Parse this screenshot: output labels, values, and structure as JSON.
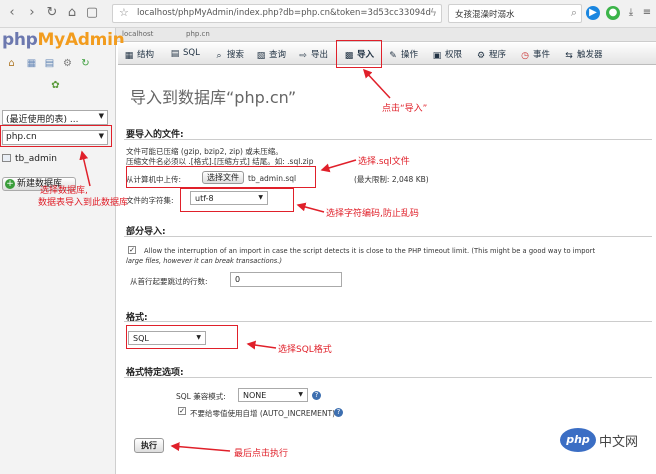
{
  "browser": {
    "url": "localhost/phpMyAdmin/index.php?db=php.cn&token=3d53cc33094d",
    "search_text": "女孩混澡时溺水",
    "frame_tabs": [
      "localhost",
      "php.cn"
    ]
  },
  "left_panel": {
    "logo_part1": "php",
    "logo_part2": "MyAdmin",
    "recent_select": "(最近使用的表) ...",
    "db_select": "php.cn",
    "table_item": "tb_admin",
    "new_db_button": "新建数据库"
  },
  "menu": {
    "tabs": [
      {
        "label": "结构",
        "icon": "structure-icon"
      },
      {
        "label": "SQL",
        "icon": "sql-icon"
      },
      {
        "label": "搜索",
        "icon": "search-icon"
      },
      {
        "label": "查询",
        "icon": "query-icon"
      },
      {
        "label": "导出",
        "icon": "export-icon"
      },
      {
        "label": "导入",
        "icon": "import-icon"
      },
      {
        "label": "操作",
        "icon": "wrench-icon"
      },
      {
        "label": "权限",
        "icon": "privileges-icon"
      },
      {
        "label": "程序",
        "icon": "routines-icon"
      },
      {
        "label": "事件",
        "icon": "events-icon"
      },
      {
        "label": "触发器",
        "icon": "triggers-icon"
      }
    ]
  },
  "main": {
    "title": "导入到数据库“php.cn”",
    "file_section": {
      "heading": "要导入的文件:",
      "desc1": "文件可能已压缩 (gzip, bzip2, zip) 或未压缩。",
      "desc2": "压缩文件名必须以 .[格式].[压缩方式] 结尾。如: .sql.zip",
      "upload_label": "从计算机中上传:",
      "choose_button": "选择文件",
      "chosen_file": "tb_admin.sql",
      "max_limit": "(最大限制: 2,048 KB)",
      "charset_label": "文件的字符集:",
      "charset_value": "utf-8"
    },
    "partial_section": {
      "heading": "部分导入:",
      "allow_interrupt_line1": "Allow the interruption of an import in case the script detects it is close to the PHP timeout limit. (This might be a good way to import",
      "allow_interrupt_line2": "large files, however it can break transactions.)",
      "skip_label": "从首行起要跳过的行数:",
      "skip_value": "0"
    },
    "format_section": {
      "heading": "格式:",
      "format_value": "SQL"
    },
    "format_options": {
      "heading": "格式特定选项:",
      "compat_label": "SQL 兼容模式:",
      "compat_value": "NONE",
      "auto_inc_label": "不要给零值使用自增 (AUTO_INCREMENT)"
    },
    "go_button": "执行"
  },
  "annotations": {
    "click_import": "点击“导入”",
    "choose_sql_file": "选择.sql文件",
    "choose_db_line1": "选择数据库,",
    "choose_db_line2": "数据表导入到此数据库",
    "choose_charset": "选择字符编码,防止乱码",
    "choose_sql_format": "选择SQL格式",
    "click_execute": "最后点击执行"
  },
  "watermark": {
    "logo": "php",
    "text": "中文网"
  },
  "colors": {
    "annotation_red": "#e0202a",
    "pma_blue": "#6c78af",
    "pma_orange": "#f29c1e"
  }
}
